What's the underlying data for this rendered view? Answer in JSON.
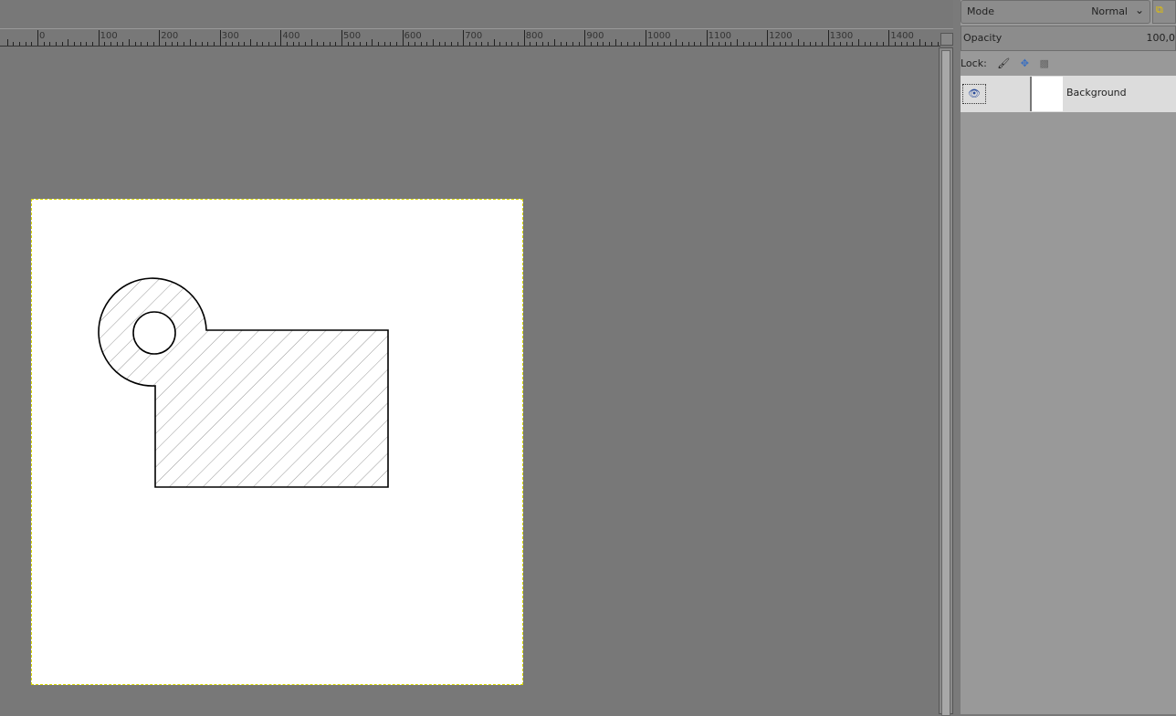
{
  "layers_panel": {
    "mode_label": "Mode",
    "mode_value": "Normal",
    "opacity_label": "Opacity",
    "opacity_value": "100,0",
    "lock_label": "Lock:",
    "layers": [
      {
        "name": "Background",
        "visible": true
      }
    ]
  },
  "ruler": {
    "labels": [
      "0",
      "100",
      "200",
      "300",
      "400",
      "500",
      "600",
      "700",
      "800",
      "900",
      "1000",
      "1100",
      "1200",
      "1300",
      "1400"
    ]
  }
}
